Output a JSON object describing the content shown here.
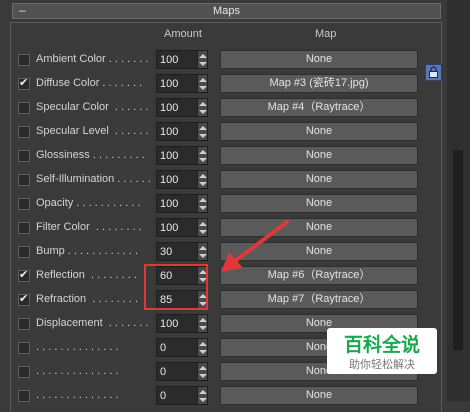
{
  "rollout": {
    "collapse_symbol": "–",
    "title": "Maps"
  },
  "columns": {
    "amount": "Amount",
    "map": "Map"
  },
  "rows": [
    {
      "label": "Ambient Color . . . . . . .",
      "checked": false,
      "amount": "100",
      "map": "None"
    },
    {
      "label": "Diffuse Color . . . . . . .",
      "checked": true,
      "amount": "100",
      "map": "Map #3 (瓷砖17.jpg)"
    },
    {
      "label": "Specular Color  . . . . . .",
      "checked": false,
      "amount": "100",
      "map": "Map #4（Raytrace）"
    },
    {
      "label": "Specular Level  . . . . . .",
      "checked": false,
      "amount": "100",
      "map": "None"
    },
    {
      "label": "Glossiness . . . . . . . . .",
      "checked": false,
      "amount": "100",
      "map": "None"
    },
    {
      "label": "Self-Illumination . . . . . .",
      "checked": false,
      "amount": "100",
      "map": "None"
    },
    {
      "label": "Opacity . . . . . . . . . . .",
      "checked": false,
      "amount": "100",
      "map": "None"
    },
    {
      "label": "Filter Color  . . . . . . . .",
      "checked": false,
      "amount": "100",
      "map": "None"
    },
    {
      "label": "Bump . . . . . . . . . . . .",
      "checked": false,
      "amount": "30",
      "map": "None"
    },
    {
      "label": "Reflection  . . . . . . . .",
      "checked": true,
      "amount": "60",
      "map": "Map #6（Raytrace）"
    },
    {
      "label": "Refraction  . . . . . . . .",
      "checked": true,
      "amount": "85",
      "map": "Map #7（Raytrace）"
    },
    {
      "label": "Displacement  . . . . . . .",
      "checked": false,
      "amount": "100",
      "map": "None"
    },
    {
      "label": ". . . . . . . . . . . . . .",
      "checked": false,
      "amount": "0",
      "map": "None"
    },
    {
      "label": ". . . . . . . . . . . . . .",
      "checked": false,
      "amount": "0",
      "map": "None"
    },
    {
      "label": ". . . . . . . . . . . . . .",
      "checked": false,
      "amount": "0",
      "map": "None"
    }
  ],
  "lock_icon": "lock-icon",
  "annotation": {
    "color": "#e0383a"
  },
  "watermark": {
    "title": "百科全说",
    "subtitle": "助你轻松解决"
  }
}
